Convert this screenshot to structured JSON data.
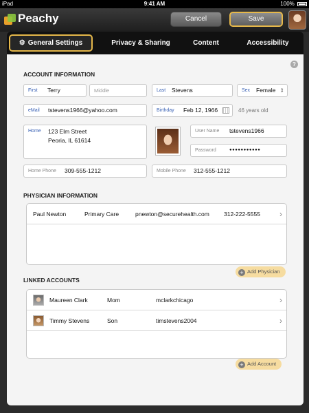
{
  "status_bar": {
    "device": "iPad",
    "time": "9:41 AM",
    "battery": "100%"
  },
  "app": {
    "title": "Peachy",
    "cancel_label": "Cancel",
    "save_label": "Save"
  },
  "tabs": [
    {
      "label": "General Settings"
    },
    {
      "label": "Privacy & Sharing"
    },
    {
      "label": "Content"
    },
    {
      "label": "Accessibility"
    }
  ],
  "help_icon": "?",
  "account": {
    "section_title": "ACCOUNT INFORMATION",
    "first_label": "First",
    "first_value": "Terry",
    "middle_placeholder": "Middle",
    "last_label": "Last",
    "last_value": "Stevens",
    "sex_label": "Sex",
    "sex_value": "Female",
    "email_label": "eMail",
    "email_value": "tstevens1966@yahoo.com",
    "birthday_label": "Birthday",
    "birthday_value": "Feb 12, 1966",
    "age_text": "46 years old",
    "home_label": "Home",
    "home_line1": "123 Elm Street",
    "home_line2": "Peoria, IL 61614",
    "username_label": "User Name",
    "username_value": "tstevens1966",
    "password_label": "Password",
    "password_value": "●●●●●●●●●●●",
    "home_phone_label": "Home Phone",
    "home_phone_value": "309-555-1212",
    "mobile_phone_label": "Mobile Phone",
    "mobile_phone_value": "312-555-1212"
  },
  "physician": {
    "section_title": "PHYSICIAN INFORMATION",
    "rows": [
      {
        "name": "Paul Newton",
        "role": "Primary Care",
        "email": "pnewton@securehealth.com",
        "phone": "312-222-5555"
      }
    ],
    "add_label": "Add Physician"
  },
  "linked": {
    "section_title": "LINKED ACCOUNTS",
    "rows": [
      {
        "name": "Maureen Clark",
        "relation": "Mom",
        "username": "mclarkchicago"
      },
      {
        "name": "Timmy Stevens",
        "relation": "Son",
        "username": "timstevens2004"
      }
    ],
    "add_label": "Add Account"
  }
}
